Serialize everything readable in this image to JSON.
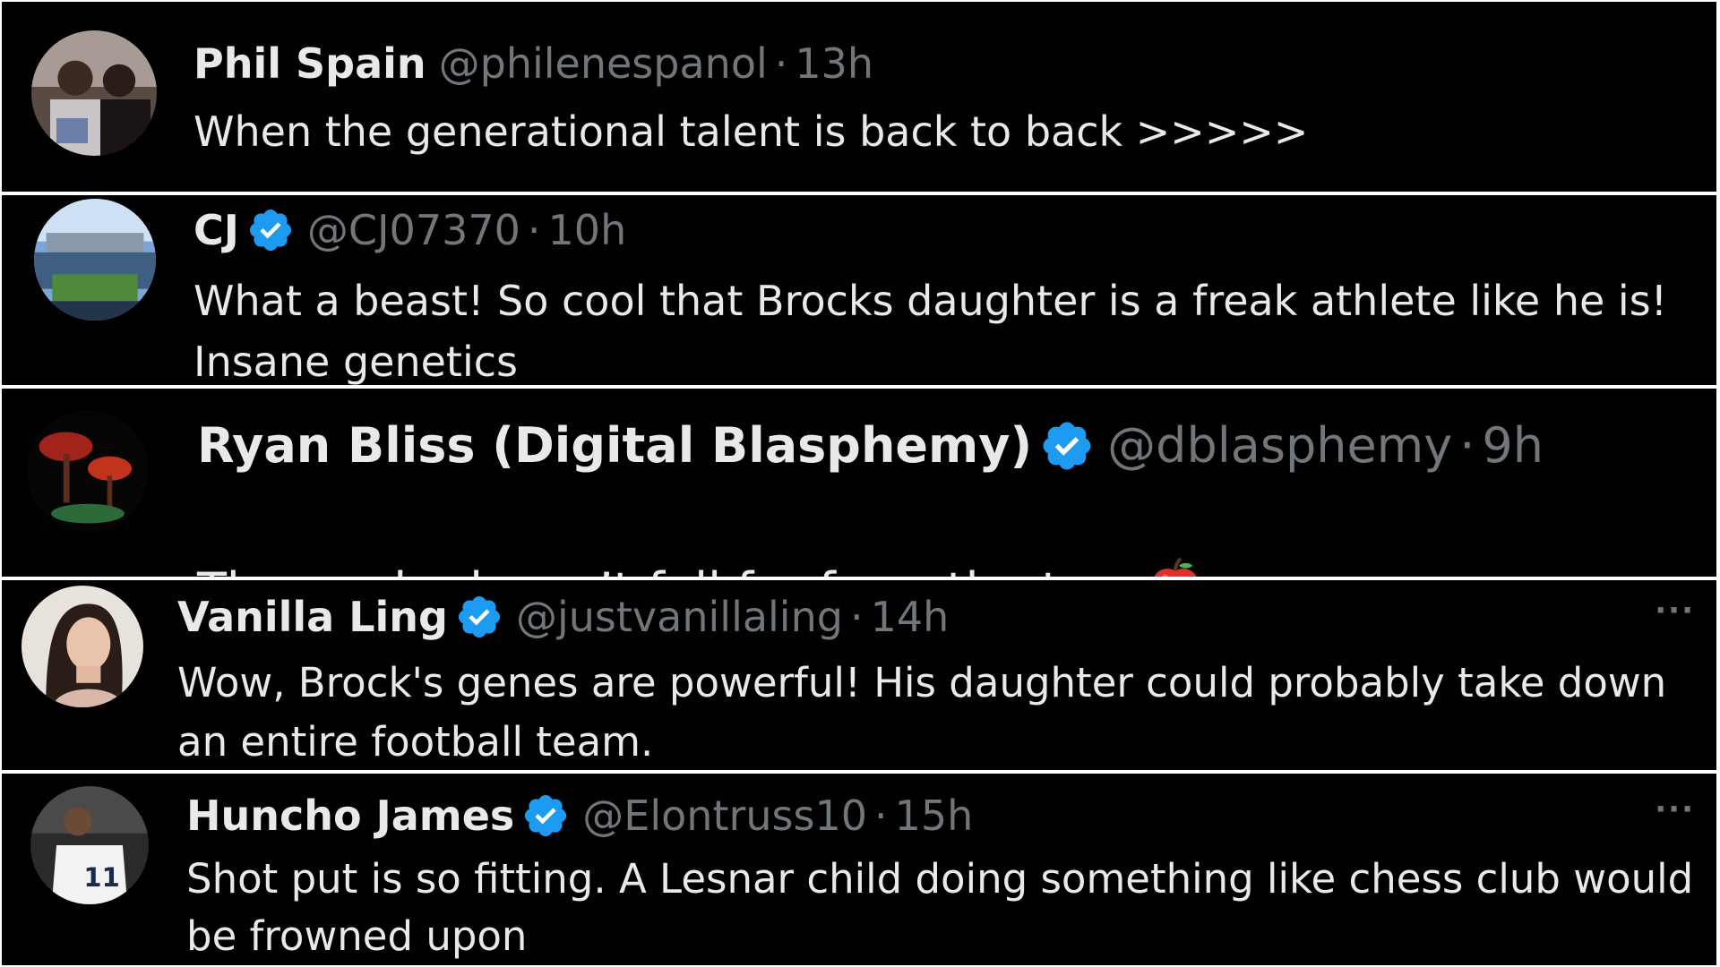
{
  "replies": [
    {
      "name": "Phil Spain",
      "verified": false,
      "handle": "@philenespanol",
      "separator": "·",
      "time": "13h",
      "text": "When the generational talent is back to back >>>>>",
      "avatar": "crowd-photo-avatar"
    },
    {
      "name": "CJ",
      "verified": true,
      "handle": "@CJ07370",
      "separator": "·",
      "time": "10h",
      "text": "What a beast! So cool that Brocks daughter is a freak athlete like he is!\nInsane genetics",
      "avatar": "stadium-photo-avatar"
    },
    {
      "name": "Ryan Bliss (Digital Blasphemy)",
      "verified": true,
      "handle": "@dblasphemy",
      "separator": "·",
      "time": "9h",
      "text": "The apple doesn’t fall far from the tree",
      "emoji": "red-apple",
      "avatar": "mushroom-art-avatar"
    },
    {
      "name": "Vanilla Ling",
      "verified": true,
      "handle": "@justvanillaling",
      "separator": "·",
      "time": "14h",
      "text": "Wow, Brock's genes are powerful! His daughter could probably take down\nan entire football team.",
      "avatar": "woman-portrait-avatar",
      "more": "···"
    },
    {
      "name": "Huncho James",
      "verified": true,
      "handle": "@Elontruss10",
      "separator": "·",
      "time": "15h",
      "text": "Shot put is so fitting. A Lesnar child doing something like chess club would\nbe frowned upon",
      "avatar": "jersey-photo-avatar",
      "more": "···"
    }
  ],
  "colors": {
    "background": "#000000",
    "primary_text": "#e7e9ea",
    "secondary_text": "#71767b",
    "verified_blue": "#1d9bf0",
    "divider": "#ffffff"
  }
}
